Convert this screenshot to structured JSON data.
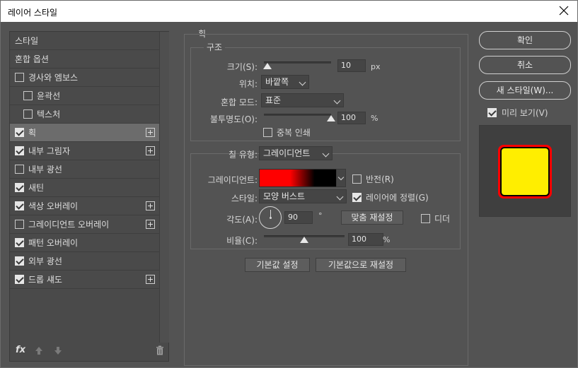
{
  "window": {
    "title": "레이어 스타일",
    "close_label": "Close"
  },
  "sidebar": {
    "items": [
      {
        "label": "스타일",
        "checkbox": false,
        "checked": false,
        "plus": false,
        "indent": false
      },
      {
        "label": "혼합 옵션",
        "checkbox": false,
        "checked": false,
        "plus": false,
        "indent": false
      },
      {
        "label": "경사와 엠보스",
        "checkbox": true,
        "checked": false,
        "plus": false,
        "indent": false
      },
      {
        "label": "윤곽선",
        "checkbox": true,
        "checked": false,
        "plus": false,
        "indent": true
      },
      {
        "label": "텍스처",
        "checkbox": true,
        "checked": false,
        "plus": false,
        "indent": true
      },
      {
        "label": "획",
        "checkbox": true,
        "checked": true,
        "plus": true,
        "indent": false,
        "selected": true
      },
      {
        "label": "내부 그림자",
        "checkbox": true,
        "checked": true,
        "plus": true,
        "indent": false
      },
      {
        "label": "내부 광선",
        "checkbox": true,
        "checked": false,
        "plus": false,
        "indent": false
      },
      {
        "label": "새틴",
        "checkbox": true,
        "checked": true,
        "plus": false,
        "indent": false
      },
      {
        "label": "색상 오버레이",
        "checkbox": true,
        "checked": true,
        "plus": true,
        "indent": false
      },
      {
        "label": "그레이디언트 오버레이",
        "checkbox": true,
        "checked": false,
        "plus": true,
        "indent": false
      },
      {
        "label": "패턴 오버레이",
        "checkbox": true,
        "checked": true,
        "plus": false,
        "indent": false
      },
      {
        "label": "외부 광선",
        "checkbox": true,
        "checked": true,
        "plus": false,
        "indent": false
      },
      {
        "label": "드롭 섀도",
        "checkbox": true,
        "checked": true,
        "plus": true,
        "indent": false
      }
    ],
    "footer": {
      "fx_label": "fx"
    }
  },
  "stroke": {
    "title": "획",
    "structure_title": "구조",
    "size_label": "크기(S):",
    "size_value": "10",
    "size_unit": "px",
    "size_slider": 0.05,
    "position_label": "위치:",
    "position_value": "바깥쪽",
    "blend_label": "혼합 모드:",
    "blend_value": "표준",
    "opacity_label": "불투명도(O):",
    "opacity_value": "100",
    "opacity_unit": "%",
    "opacity_slider": 1.0,
    "overprint_label": "중복 인쇄",
    "overprint_checked": false,
    "fill_type_label": "칠 유형:",
    "fill_type_value": "그레이디언트",
    "gradient_label": "그레이디언트:",
    "reverse_label": "반전(R)",
    "reverse_checked": false,
    "style_label": "스타일:",
    "style_value": "모양 버스트",
    "align_label": "레이어에 정렬(G)",
    "align_checked": true,
    "angle_label": "각도(A):",
    "angle_value": "90",
    "angle_unit": "°",
    "reset_alignment_label": "맞춤 재설정",
    "dither_label": "디더",
    "dither_checked": false,
    "scale_label": "비율(C):",
    "scale_value": "100",
    "scale_unit": "%",
    "scale_slider": 0.5,
    "make_default_label": "기본값 설정",
    "reset_default_label": "기본값으로 재설정"
  },
  "actions": {
    "ok_label": "확인",
    "cancel_label": "취소",
    "new_style_label": "새 스타일(W)...",
    "preview_label": "미리 보기(V)",
    "preview_checked": true
  },
  "colors": {
    "stroke_gradient_start": "#ff0000",
    "stroke_gradient_end": "#000000",
    "preview_fill": "#ffee00",
    "preview_border": "#ff0000"
  }
}
